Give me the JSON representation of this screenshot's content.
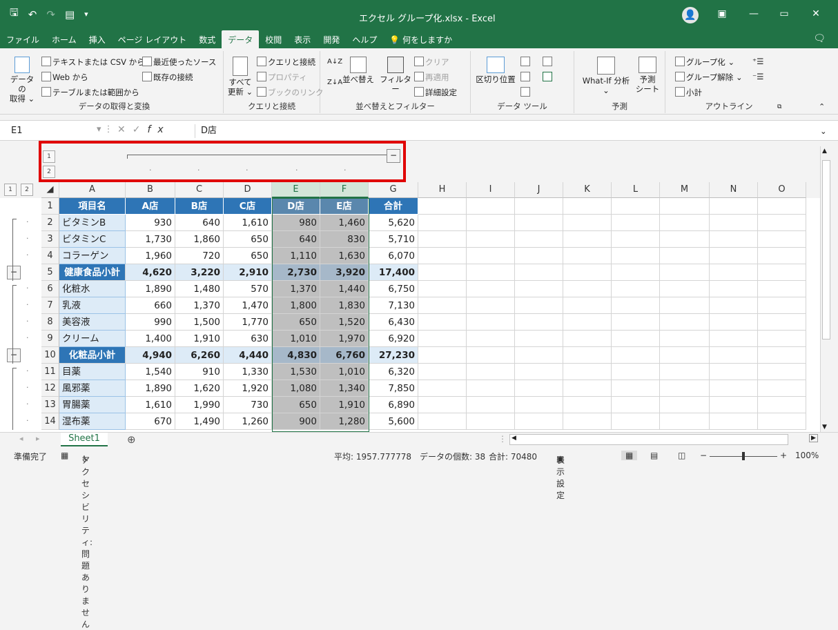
{
  "window": {
    "title": "エクセル グループ化.xlsx  -  Excel",
    "minimize": "—",
    "restore": "▭",
    "close": "✕",
    "ribbon_display": "▣"
  },
  "qat": {
    "save": "🖫",
    "undo": "↶",
    "redo": "↷",
    "preview": "▤",
    "more": "▾"
  },
  "tabs": [
    "ファイル",
    "ホーム",
    "挿入",
    "ページ レイアウト",
    "数式",
    "データ",
    "校閲",
    "表示",
    "開発",
    "ヘルプ",
    "何をしますか"
  ],
  "ribbon": {
    "get_data": "データの\n取得 ⌄",
    "text_csv": "テキストまたは CSV から",
    "web": "Web から",
    "table_range": "テーブルまたは範囲から",
    "recent": "最近使ったソース",
    "existing": "既存の接続",
    "group1": "データの取得と変換",
    "refresh_all": "すべて\n更新 ⌄",
    "queries": "クエリと接続",
    "properties": "プロパティ",
    "edit_links": "ブックのリンク",
    "group2": "クエリと接続",
    "sort_az": "A↓Z",
    "sort_za": "Z↓A",
    "sort": "並べ替え",
    "filter": "フィルター",
    "clear": "クリア",
    "reapply": "再適用",
    "advanced": "詳細設定",
    "group3": "並べ替えとフィルター",
    "text_to_col": "区切り位置",
    "group4": "データ ツール",
    "whatif": "What-If 分析\n⌄",
    "forecast": "予測\nシート",
    "group5": "予測",
    "group_btn": "グループ化",
    "ungroup": "グループ解除",
    "subtotal": "小計",
    "group6": "アウトライン"
  },
  "formula_bar": {
    "name_box": "E1",
    "content": "D店",
    "fx": "fx"
  },
  "outline": {
    "level1": "1",
    "level2": "2",
    "collapse": "−"
  },
  "columns": [
    "A",
    "B",
    "C",
    "D",
    "E",
    "F",
    "G",
    "H",
    "I",
    "J",
    "K",
    "L",
    "M",
    "N",
    "O"
  ],
  "header_row": [
    "項目名",
    "A店",
    "B店",
    "C店",
    "D店",
    "E店",
    "合計"
  ],
  "rows": [
    {
      "n": "2",
      "cells": [
        "ビタミンB",
        "930",
        "640",
        "1,610",
        "980",
        "1,460",
        "5,620"
      ],
      "sub": false
    },
    {
      "n": "3",
      "cells": [
        "ビタミンC",
        "1,730",
        "1,860",
        "650",
        "640",
        "830",
        "5,710"
      ],
      "sub": false
    },
    {
      "n": "4",
      "cells": [
        "コラーゲン",
        "1,960",
        "720",
        "650",
        "1,110",
        "1,630",
        "6,070"
      ],
      "sub": false
    },
    {
      "n": "5",
      "cells": [
        "健康食品小計",
        "4,620",
        "3,220",
        "2,910",
        "2,730",
        "3,920",
        "17,400"
      ],
      "sub": true
    },
    {
      "n": "6",
      "cells": [
        "化粧水",
        "1,890",
        "1,480",
        "570",
        "1,370",
        "1,440",
        "6,750"
      ],
      "sub": false
    },
    {
      "n": "7",
      "cells": [
        "乳液",
        "660",
        "1,370",
        "1,470",
        "1,800",
        "1,830",
        "7,130"
      ],
      "sub": false
    },
    {
      "n": "8",
      "cells": [
        "美容液",
        "990",
        "1,500",
        "1,770",
        "650",
        "1,520",
        "6,430"
      ],
      "sub": false
    },
    {
      "n": "9",
      "cells": [
        "クリーム",
        "1,400",
        "1,910",
        "630",
        "1,010",
        "1,970",
        "6,920"
      ],
      "sub": false
    },
    {
      "n": "10",
      "cells": [
        "化粧品小計",
        "4,940",
        "6,260",
        "4,440",
        "4,830",
        "6,760",
        "27,230"
      ],
      "sub": true
    },
    {
      "n": "11",
      "cells": [
        "目薬",
        "1,540",
        "910",
        "1,330",
        "1,530",
        "1,010",
        "6,320"
      ],
      "sub": false
    },
    {
      "n": "12",
      "cells": [
        "風邪薬",
        "1,890",
        "1,620",
        "1,920",
        "1,080",
        "1,340",
        "7,850"
      ],
      "sub": false
    },
    {
      "n": "13",
      "cells": [
        "胃腸薬",
        "1,610",
        "1,990",
        "730",
        "650",
        "1,910",
        "6,890"
      ],
      "sub": false
    },
    {
      "n": "14",
      "cells": [
        "湿布薬",
        "670",
        "1,490",
        "1,260",
        "900",
        "1,280",
        "5,600"
      ],
      "sub": false
    }
  ],
  "sheet": {
    "name": "Sheet1",
    "add": "⊕"
  },
  "status": {
    "ready": "準備完了",
    "accessibility": "アクセシビリティ: 問題ありません",
    "average": "平均: 1957.777778",
    "count": "データの個数: 38",
    "sum": "合計: 70480",
    "display": "表示設定",
    "zoom": "100%"
  }
}
